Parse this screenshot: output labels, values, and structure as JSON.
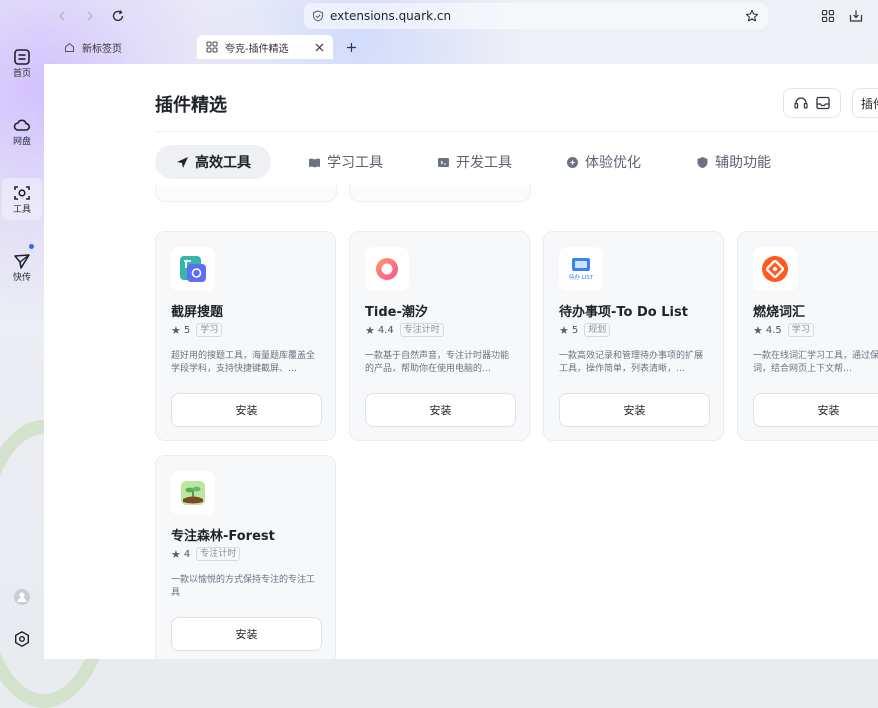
{
  "rail": {
    "items": [
      {
        "label": "首页"
      },
      {
        "label": "网盘"
      },
      {
        "label": "工具"
      },
      {
        "label": "快传"
      }
    ]
  },
  "urlbar": {
    "url": "extensions.quark.cn"
  },
  "tabs": [
    {
      "title": "新标签页",
      "active": false
    },
    {
      "title": "夸克-插件精选",
      "active": true
    }
  ],
  "page": {
    "title": "插件精选",
    "header_button_partial": "插件"
  },
  "categories": [
    {
      "label": "高效工具",
      "icon": "send-icon",
      "active": true
    },
    {
      "label": "学习工具",
      "icon": "book-icon",
      "active": false
    },
    {
      "label": "开发工具",
      "icon": "code-icon",
      "active": false
    },
    {
      "label": "体验优化",
      "icon": "sparkle-icon",
      "active": false
    },
    {
      "label": "辅助功能",
      "icon": "shield-icon",
      "active": false
    }
  ],
  "extensions": [
    {
      "name": "截屏搜题",
      "rating": "5",
      "tag": "学习",
      "desc": "超好用的搜题工具，海量题库覆盖全学段学科，支持快捷键截屏、…",
      "install": "安装",
      "logo_icon": "search-question-icon"
    },
    {
      "name": "Tide-潮汐",
      "rating": "4.4",
      "tag": "专注计时",
      "desc": "一款基于自然声音，专注计时器功能的产品，帮助你在使用电脑的…",
      "install": "安装",
      "logo_icon": "tide-ring-icon"
    },
    {
      "name": "待办事项-To Do List",
      "rating": "5",
      "tag": "规划",
      "desc": "一款高效记录和管理待办事项的扩展工具，操作简单，列表清晰，…",
      "install": "安装",
      "logo_icon": "todo-list-icon",
      "logo_text": "待办 LIST"
    },
    {
      "name": "燃烧词汇",
      "rating": "4.5",
      "tag": "学习",
      "desc": "一款在线词汇学习工具，通过保存生词，结合网页上下文帮…",
      "install": "安装",
      "logo_icon": "burn-words-icon"
    },
    {
      "name": "专注森林-Forest",
      "rating": "4",
      "tag": "专注计时",
      "desc": "一款以愉悦的方式保持专注的专注工具",
      "install": "安装",
      "logo_icon": "forest-sprout-icon"
    }
  ],
  "colors": {
    "accent": "#2f6bff",
    "card_bg": "#f7f8fa",
    "burn_orange": "#ff5a1f",
    "tide_pink": "#ff6f6f"
  }
}
